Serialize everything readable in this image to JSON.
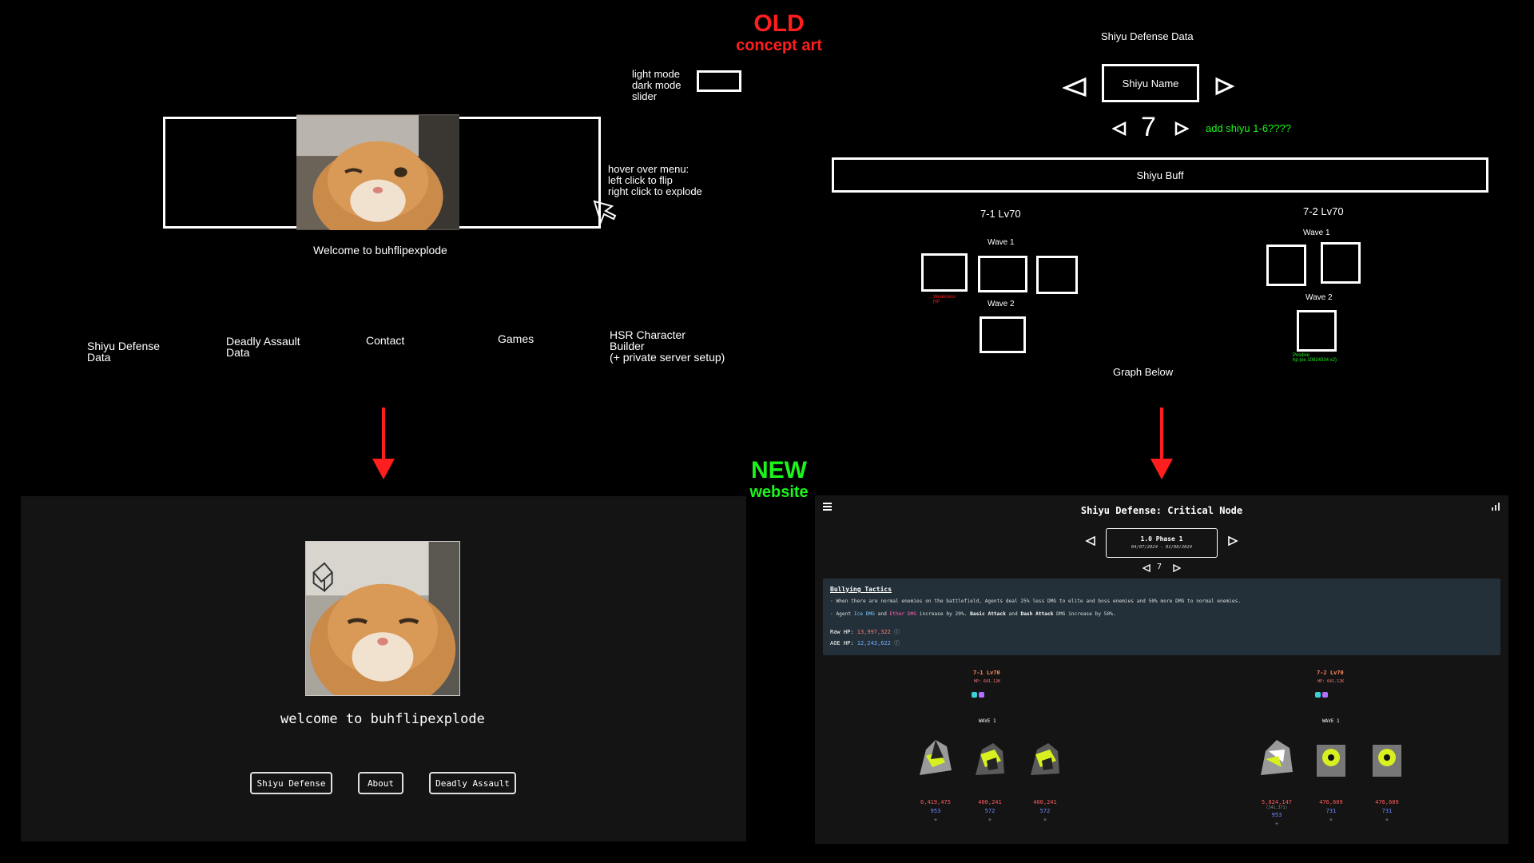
{
  "headings": {
    "old_title": "OLD",
    "old_sub": "concept art",
    "new_title": "NEW",
    "new_sub": "website"
  },
  "old_home": {
    "mode_lines": [
      "light mode",
      "dark mode",
      "slider"
    ],
    "hover_lines": [
      "hover over menu:",
      "left click to flip",
      "right click to explode"
    ],
    "welcome": "Welcome to buhflipexplode",
    "menu": [
      [
        "Shiyu Defense",
        "Data"
      ],
      [
        "Deadly Assault",
        "Data"
      ],
      [
        "Contact"
      ],
      [
        "Games"
      ],
      [
        "HSR Character",
        "Builder",
        "(+ private server setup)"
      ]
    ]
  },
  "old_shiyu": {
    "title": "Shiyu Defense Data",
    "name_box": "Shiyu Name",
    "floor": "7",
    "add_note": "add shiyu 1-6????",
    "buff_box": "Shiyu Buff",
    "left_node": "7-1 Lv70",
    "right_node": "7-2 Lv70",
    "wave1": "Wave 1",
    "wave2": "Wave 2",
    "left_note": [
      "Weakness",
      "HP"
    ],
    "right_note": [
      "Positive",
      "hp (ex 10824334 x2)"
    ],
    "graph": "Graph Below"
  },
  "new_home": {
    "welcome": "welcome to buhflipexplode",
    "buttons": [
      "Shiyu Defense",
      "About",
      "Deadly Assault"
    ]
  },
  "new_shiyu": {
    "title": "Shiyu Defense: Critical Node",
    "phase": "1.0 Phase 1",
    "dates": "04/07/2024 - 01/08/2024",
    "floor": "7",
    "buff_title": "Bullying Tactics",
    "buff_line1": "· When there are normal enemies on the battlefield, Agents deal 25% less DMG to elite and boss enemies and 50% more DMG to normal enemies.",
    "buff_line2_parts": [
      "· Agent ",
      "Ice DMG",
      " and ",
      "Ether DMG",
      " increase by 20%. ",
      "Basic Attack",
      " and ",
      "Dash Attack",
      " DMG increase by 50%."
    ],
    "raw_hp_label": "Raw HP:",
    "raw_hp_value": "13,997,322",
    "aoe_hp_label": "AOE HP:",
    "aoe_hp_value": "12,243,622",
    "left_node": "7-1 Lv70",
    "left_hp": "HP: 641.12K",
    "right_node": "7-2 Lv70",
    "right_hp": "HP: 641.12K",
    "wave": "WAVE 1",
    "left_enemies": [
      {
        "hp": "6,419,475",
        "def": "953"
      },
      {
        "hp": "400,241",
        "def": "572"
      },
      {
        "hp": "400,241",
        "def": "572"
      }
    ],
    "right_enemies": [
      {
        "hp": "5,824,147",
        "sub": "(341,371)",
        "def": "953"
      },
      {
        "hp": "476,609",
        "def": "731"
      },
      {
        "hp": "476,609",
        "def": "731"
      }
    ],
    "plus": "+"
  },
  "colors": {
    "old": "#ff1e1e",
    "new": "#1cf51c",
    "accent_red": "#ff5a5a",
    "accent_blue": "#6f8bff"
  }
}
